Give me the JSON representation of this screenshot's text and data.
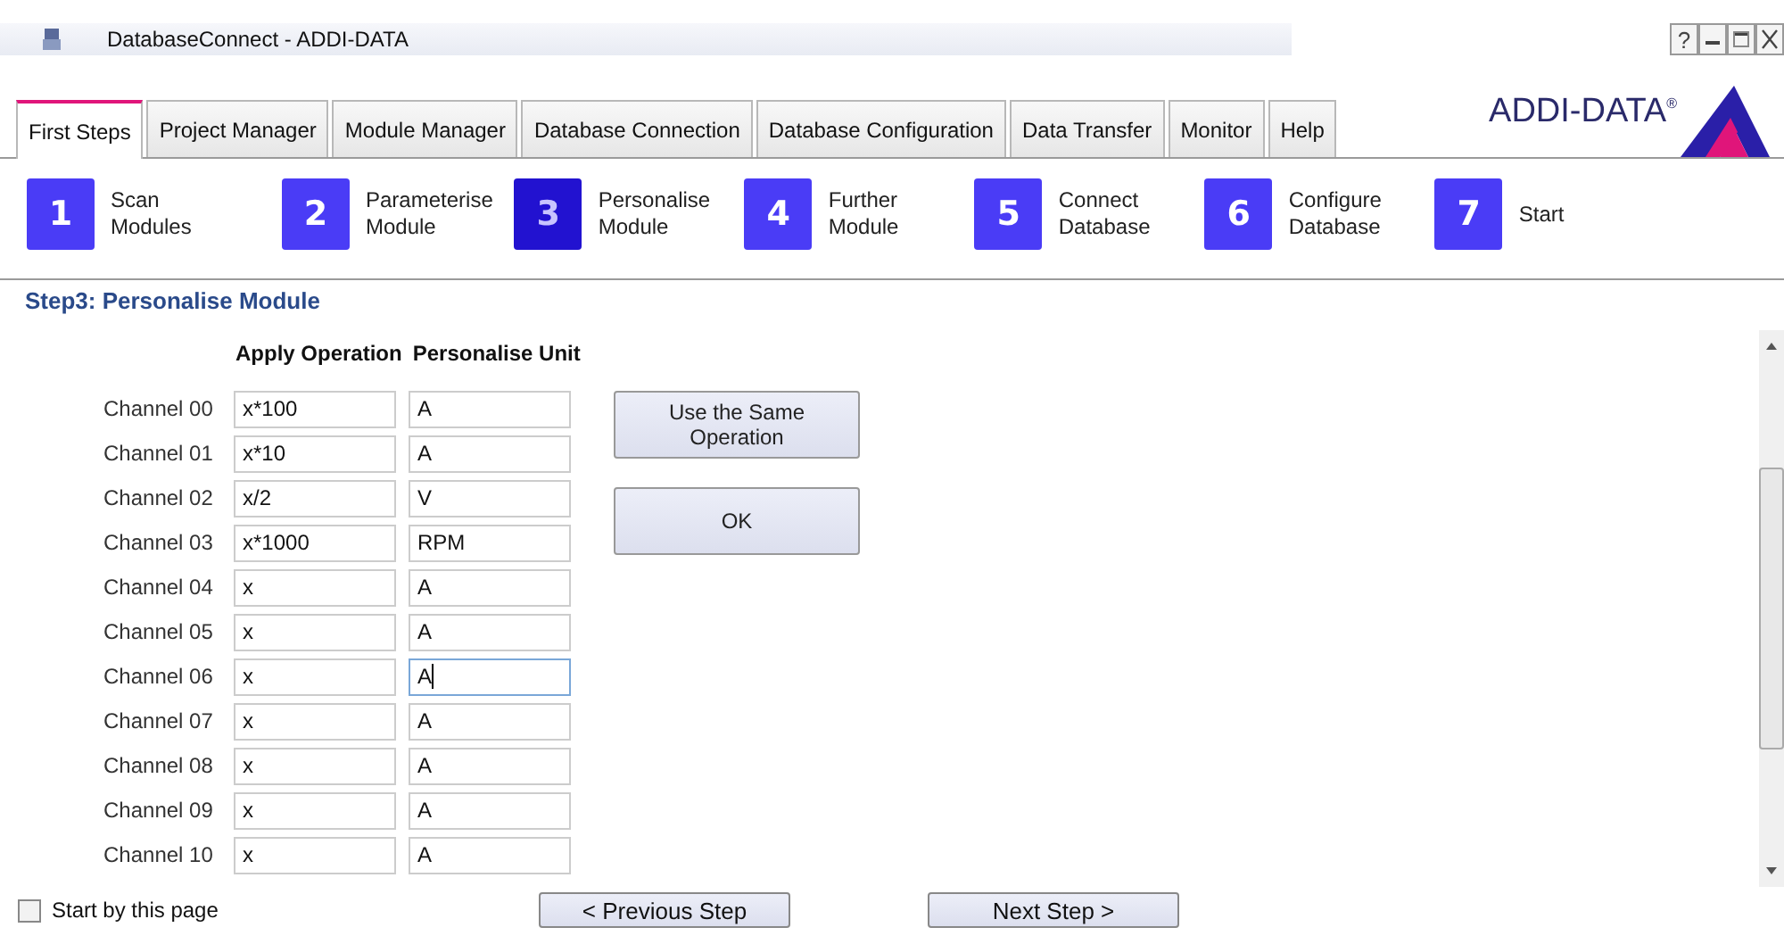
{
  "window": {
    "title": "DatabaseConnect - ADDI-DATA",
    "help_button": "?"
  },
  "tabs": [
    {
      "label": "First Steps",
      "selected": true
    },
    {
      "label": "Project Manager",
      "selected": false
    },
    {
      "label": "Module Manager",
      "selected": false
    },
    {
      "label": "Database Connection",
      "selected": false
    },
    {
      "label": "Database Configuration",
      "selected": false
    },
    {
      "label": "Data Transfer",
      "selected": false
    },
    {
      "label": "Monitor",
      "selected": false
    },
    {
      "label": "Help",
      "selected": false
    }
  ],
  "logo": {
    "text": "ADDI-DATA$^{®}$"
  },
  "steps": [
    {
      "number": "1",
      "label": [
        "Scan",
        "Modules"
      ],
      "selected": false
    },
    {
      "number": "2",
      "label": [
        "Parameterise",
        "Module"
      ],
      "selected": false
    },
    {
      "number": "3",
      "label": [
        "Personalise",
        "Module"
      ],
      "selected": true
    },
    {
      "number": "4",
      "label": [
        "Further",
        "Module"
      ],
      "selected": false
    },
    {
      "number": "5",
      "label": [
        "Connect",
        "Database"
      ],
      "selected": false
    },
    {
      "number": "6",
      "label": [
        "Configure",
        "Database"
      ],
      "selected": false
    },
    {
      "number": "7",
      "label": [
        "Start"
      ],
      "selected": false
    }
  ],
  "section_title": "Step3: Personalise Module",
  "columns": [
    "Apply Operation",
    "Personalise Unit"
  ],
  "channels": [
    {
      "name": "Channel 00",
      "operation": "x*100",
      "unit": "A",
      "focused": false
    },
    {
      "name": "Channel 01",
      "operation": "x*10",
      "unit": "A",
      "focused": false
    },
    {
      "name": "Channel 02",
      "operation": "x/2",
      "unit": "V",
      "focused": false
    },
    {
      "name": "Channel 03",
      "operation": "x*1000",
      "unit": "RPM",
      "focused": false
    },
    {
      "name": "Channel 04",
      "operation": "x",
      "unit": "A",
      "focused": false
    },
    {
      "name": "Channel 05",
      "operation": "x",
      "unit": "A",
      "focused": false
    },
    {
      "name": "Channel 06",
      "operation": "x",
      "unit": "A",
      "focused": true
    },
    {
      "name": "Channel 07",
      "operation": "x",
      "unit": "A",
      "focused": false
    },
    {
      "name": "Channel 08",
      "operation": "x",
      "unit": "A",
      "focused": false
    },
    {
      "name": "Channel 09",
      "operation": "x",
      "unit": "A",
      "focused": false
    },
    {
      "name": "Channel 10",
      "operation": "x",
      "unit": "A",
      "focused": false
    }
  ],
  "side_buttons": [
    "Use the Same Operation",
    "OK"
  ],
  "start_checkbox": {
    "label": "Start by this page",
    "checked": false
  },
  "nav_buttons": [
    "< Previous Step",
    "Next Step >"
  ]
}
